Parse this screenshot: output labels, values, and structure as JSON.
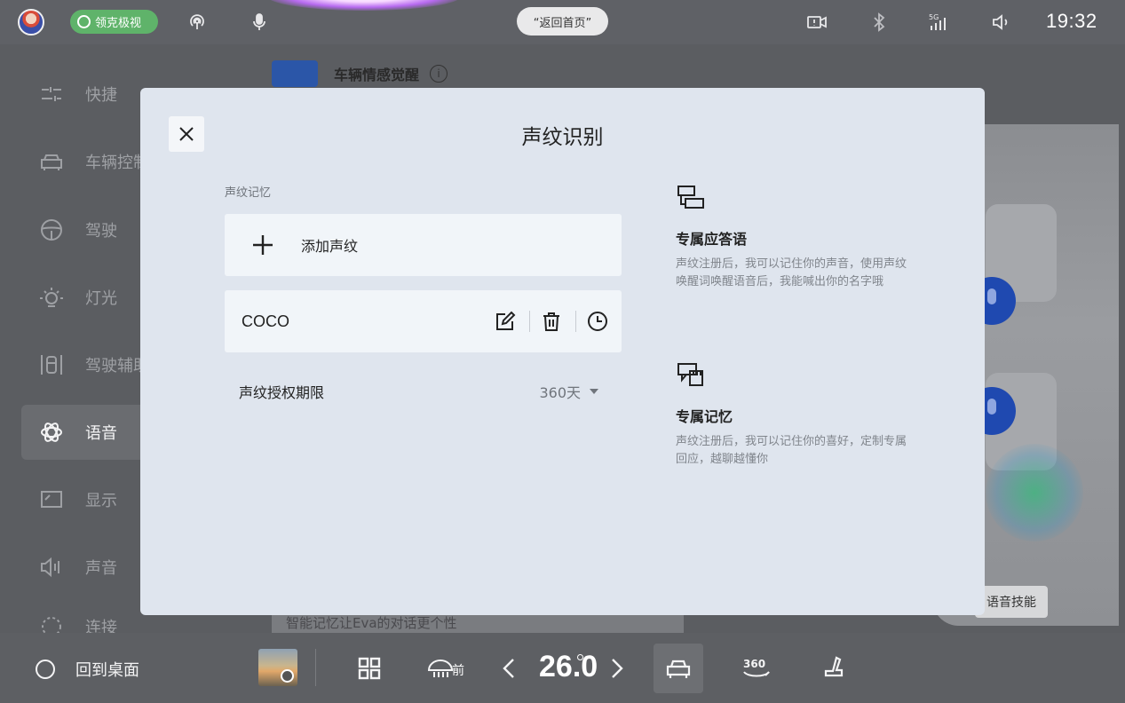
{
  "statusbar": {
    "brand_label": "领克极视",
    "home_pill_label": "“返回首页”",
    "clock": "19:32",
    "icons": [
      "avatar",
      "steering-badge-icon",
      "podcast-icon",
      "mic-icon",
      "camera-alert-icon",
      "bluetooth-icon",
      "signal-5g-icon",
      "volume-icon"
    ]
  },
  "sidebar": {
    "items": [
      {
        "label": "快捷",
        "icon": "shortcut-sliders-icon"
      },
      {
        "label": "车辆控制",
        "icon": "car-icon"
      },
      {
        "label": "驾驶",
        "icon": "steering-wheel-icon"
      },
      {
        "label": "灯光",
        "icon": "light-icon"
      },
      {
        "label": "驾驶辅助",
        "icon": "driver-assist-icon"
      },
      {
        "label": "语音",
        "icon": "voice-assistant-icon",
        "active": true
      },
      {
        "label": "显示",
        "icon": "display-icon"
      },
      {
        "label": "声音",
        "icon": "sound-icon"
      },
      {
        "label": "连接",
        "icon": "connection-icon"
      }
    ]
  },
  "background": {
    "header_title": "车辆情感觉醒",
    "strip_text": "智能记忆让Eva的对话更个性",
    "skill_button": "语音技能"
  },
  "modal": {
    "title": "声纹识别",
    "section_label": "声纹记忆",
    "add_label": "添加声纹",
    "profiles": [
      {
        "name": "COCO"
      }
    ],
    "period": {
      "label": "声纹授权期限",
      "value": "360天"
    },
    "features": [
      {
        "title": "专属应答语",
        "desc": "声纹注册后，我可以记住你的声音，使用声纹唤醒词唤醒语音后，我能喊出你的名字哦",
        "icon": "chat-bubbles-icon"
      },
      {
        "title": "专属记忆",
        "desc": "声纹注册后，我可以记住你的喜好，定制专属回应，越聊越懂你",
        "icon": "memory-card-icon"
      }
    ]
  },
  "dock": {
    "home_label": "回到桌面",
    "front_defrost_label": "前",
    "temperature": "26.0"
  },
  "colors": {
    "modal_bg": "#dfe5ee",
    "card_bg": "#f1f5f9",
    "active_brand": "#5fb36a",
    "mic_blue": "#1f49b0"
  }
}
